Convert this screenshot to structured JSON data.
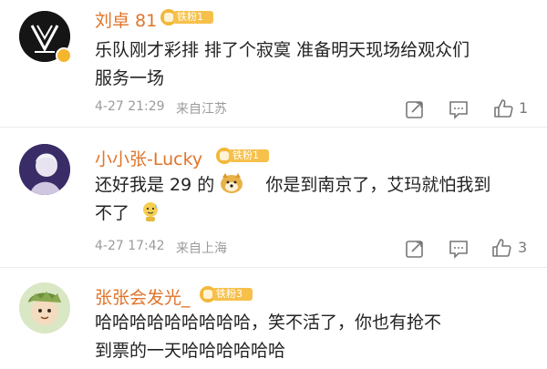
{
  "comments": [
    {
      "username": "刘卓 81",
      "fan_badge": "铁粉1",
      "text_line1": "乐队刚才彩排 排了个寂寞 准备明天现场给观众们",
      "text_line2": "服务一场",
      "timestamp": "4-27 21:29",
      "location": "来自江苏",
      "like_count": "1",
      "avatar_icon": "logo-avatar-icon"
    },
    {
      "username": "小小张-Lucky",
      "fan_badge": "铁粉1",
      "text_line1a": "还好我是 29 的",
      "text_line1b": "你是到南京了，艾玛就怕我到",
      "text_line2": "不了",
      "timestamp": "4-27 17:42",
      "location": "来自上海",
      "like_count": "3",
      "emojis": [
        "doge-emoji",
        "sweat-emoji"
      ]
    },
    {
      "username": "张张会发光_",
      "fan_badge": "铁粉3",
      "text_line1": "哈哈哈哈哈哈哈哈哈，笑不活了，你也有抢不",
      "text_line2": "到票的一天哈哈哈哈哈哈",
      "avatar_icon": "cartoon-avatar-icon"
    }
  ],
  "colors": {
    "username": "#e0742a",
    "badge": "#f6c04a",
    "meta": "#9b9b9b"
  },
  "icons": [
    "share-icon",
    "comment-icon",
    "like-icon"
  ]
}
